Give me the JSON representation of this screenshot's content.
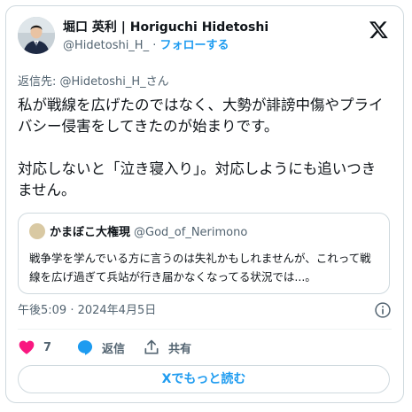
{
  "author": {
    "name": "堀口 英利 | Horiguchi Hidetoshi",
    "handle": "@Hidetoshi_H_",
    "separator": "·",
    "follow_label": "フォローする"
  },
  "reply_to": "返信先: @Hidetoshi_H_さん",
  "tweet": {
    "paragraph_1": "私が戦線を広げたのではなく、大勢が誹謗中傷やプライバシー侵害をしてきたのが始まりです。",
    "paragraph_2": "対応しないと「泣き寝入り」。対応しようにも追いつきません。"
  },
  "quoted_tweet": {
    "name": "かまぼこ大権現",
    "handle": "@God_of_Nerimono",
    "text": "戦争学を学んでいる方に言うのは失礼かもしれませんが、これって戦線を広げ過ぎて兵站が行き届かなくなってる状況では...。"
  },
  "timestamp": "午後5:09 · 2024年4月5日",
  "actions": {
    "like_count": "7",
    "reply_label": "返信",
    "share_label": "共有"
  },
  "read_more_label": "Xでもっと読む",
  "icons": {
    "logo": "x-logo-icon",
    "info": "info-icon",
    "like": "heart-icon",
    "reply": "reply-bubble-icon",
    "share": "share-icon"
  },
  "colors": {
    "accent": "#1d9bf0",
    "like": "#f91880",
    "secondary_text": "#536471",
    "border": "#cfd9de"
  }
}
